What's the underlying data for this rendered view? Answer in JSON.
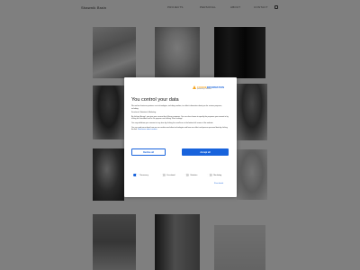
{
  "header": {
    "brand": "Shawnik Brain",
    "nav": [
      "PROJECTS",
      "PERSONAL",
      "ABOUT",
      "CONTACT"
    ],
    "icons": [
      "instagram-icon"
    ]
  },
  "consent": {
    "logo_text_a": "COOKIE",
    "logo_text_b": "INFORMATION",
    "logo_sub": "powered by Cookiebot",
    "title": "You control your data",
    "paragraphs": [
      "We and our business partners use technologies, including cookies, to collect information about you for various purposes, including:",
      "Functional, Statistical, Marketing",
      "By clicking 'Accept', you give your consent for all these purposes. You can also choose to specify the purposes you consent to by ticking the checkbox next to the purpose and clicking 'Save settings'.",
      "You may withdraw your consent at any time by clicking the small icon at the bottom left corner of the website.",
      "You can read more about how we use cookies and other technologies and how we collect and process personal data by clicking the link."
    ],
    "read_more": "Read more about cookies",
    "decline_label": "Decline all",
    "accept_label": "Accept all",
    "toggles": [
      {
        "label": "Necessary",
        "on": true
      },
      {
        "label": "Functional",
        "on": false
      },
      {
        "label": "Statistics",
        "on": false
      },
      {
        "label": "Marketing",
        "on": false
      }
    ],
    "show_details": "Show details",
    "accent_color": "#1863dc"
  }
}
